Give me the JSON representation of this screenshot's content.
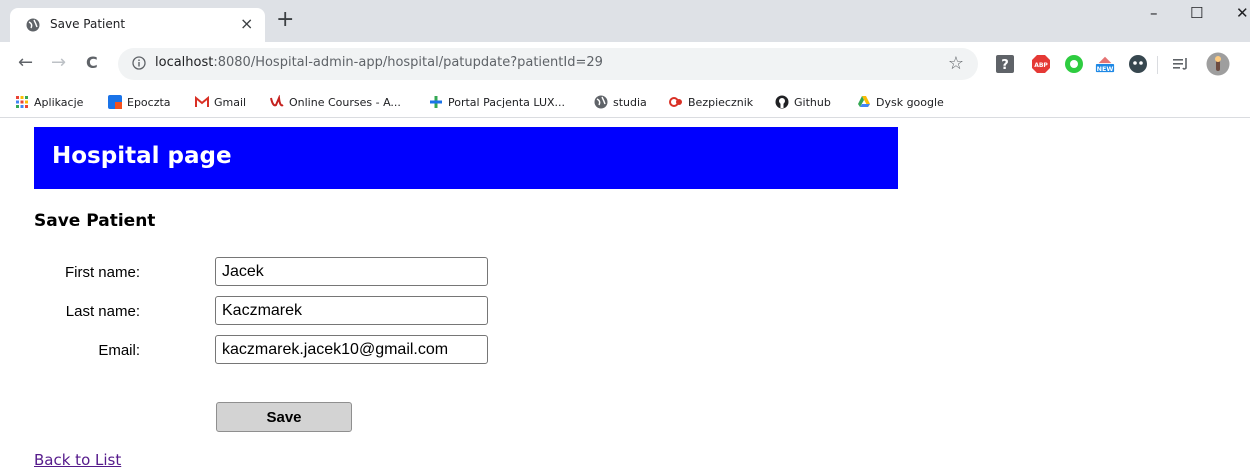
{
  "browser": {
    "tab": {
      "title": "Save Patient",
      "close": "×"
    },
    "new_tab": "+",
    "window_controls": {
      "minimize": "–",
      "maximize": "☐",
      "close": "✕"
    },
    "nav": {
      "back": "←",
      "forward": "→",
      "reload": "C"
    },
    "address": {
      "host": "localhost",
      "path": ":8080/Hospital-admin-app/hospital/patupdate?patientId=29"
    },
    "bookmarks": [
      {
        "label": "Aplikacje",
        "icon": "apps-grid-icon",
        "color": "#e8453c"
      },
      {
        "label": "Epoczta",
        "icon": "epoczta-icon",
        "color": "#1a73e8"
      },
      {
        "label": "Gmail",
        "icon": "gmail-icon",
        "color": "#d93025"
      },
      {
        "label": "Online Courses - A...",
        "icon": "courses-icon",
        "color": "#c5221f"
      },
      {
        "label": "Portal Pacjenta LUX...",
        "icon": "portal-icon",
        "color": "#34a853"
      },
      {
        "label": "studia",
        "icon": "globe-icon",
        "color": "#5f6368"
      },
      {
        "label": "Bezpiecznik",
        "icon": "bezpiecznik-icon",
        "color": "#d93025"
      },
      {
        "label": "Github",
        "icon": "github-icon",
        "color": "#202124"
      },
      {
        "label": "Dysk google",
        "icon": "drive-icon",
        "color": "#fbbc04"
      }
    ]
  },
  "page": {
    "header_title": "Hospital page",
    "title": "Save Patient",
    "form": {
      "first_name": {
        "label": "First name:",
        "value": "Jacek"
      },
      "last_name": {
        "label": "Last name:",
        "value": "Kaczmarek"
      },
      "email": {
        "label": "Email:",
        "value": "kaczmarek.jacek10@gmail.com"
      },
      "save_label": "Save"
    },
    "back_link": "Back to List"
  },
  "colors": {
    "header_bg": "#0000ff",
    "link": "#551a8b"
  }
}
